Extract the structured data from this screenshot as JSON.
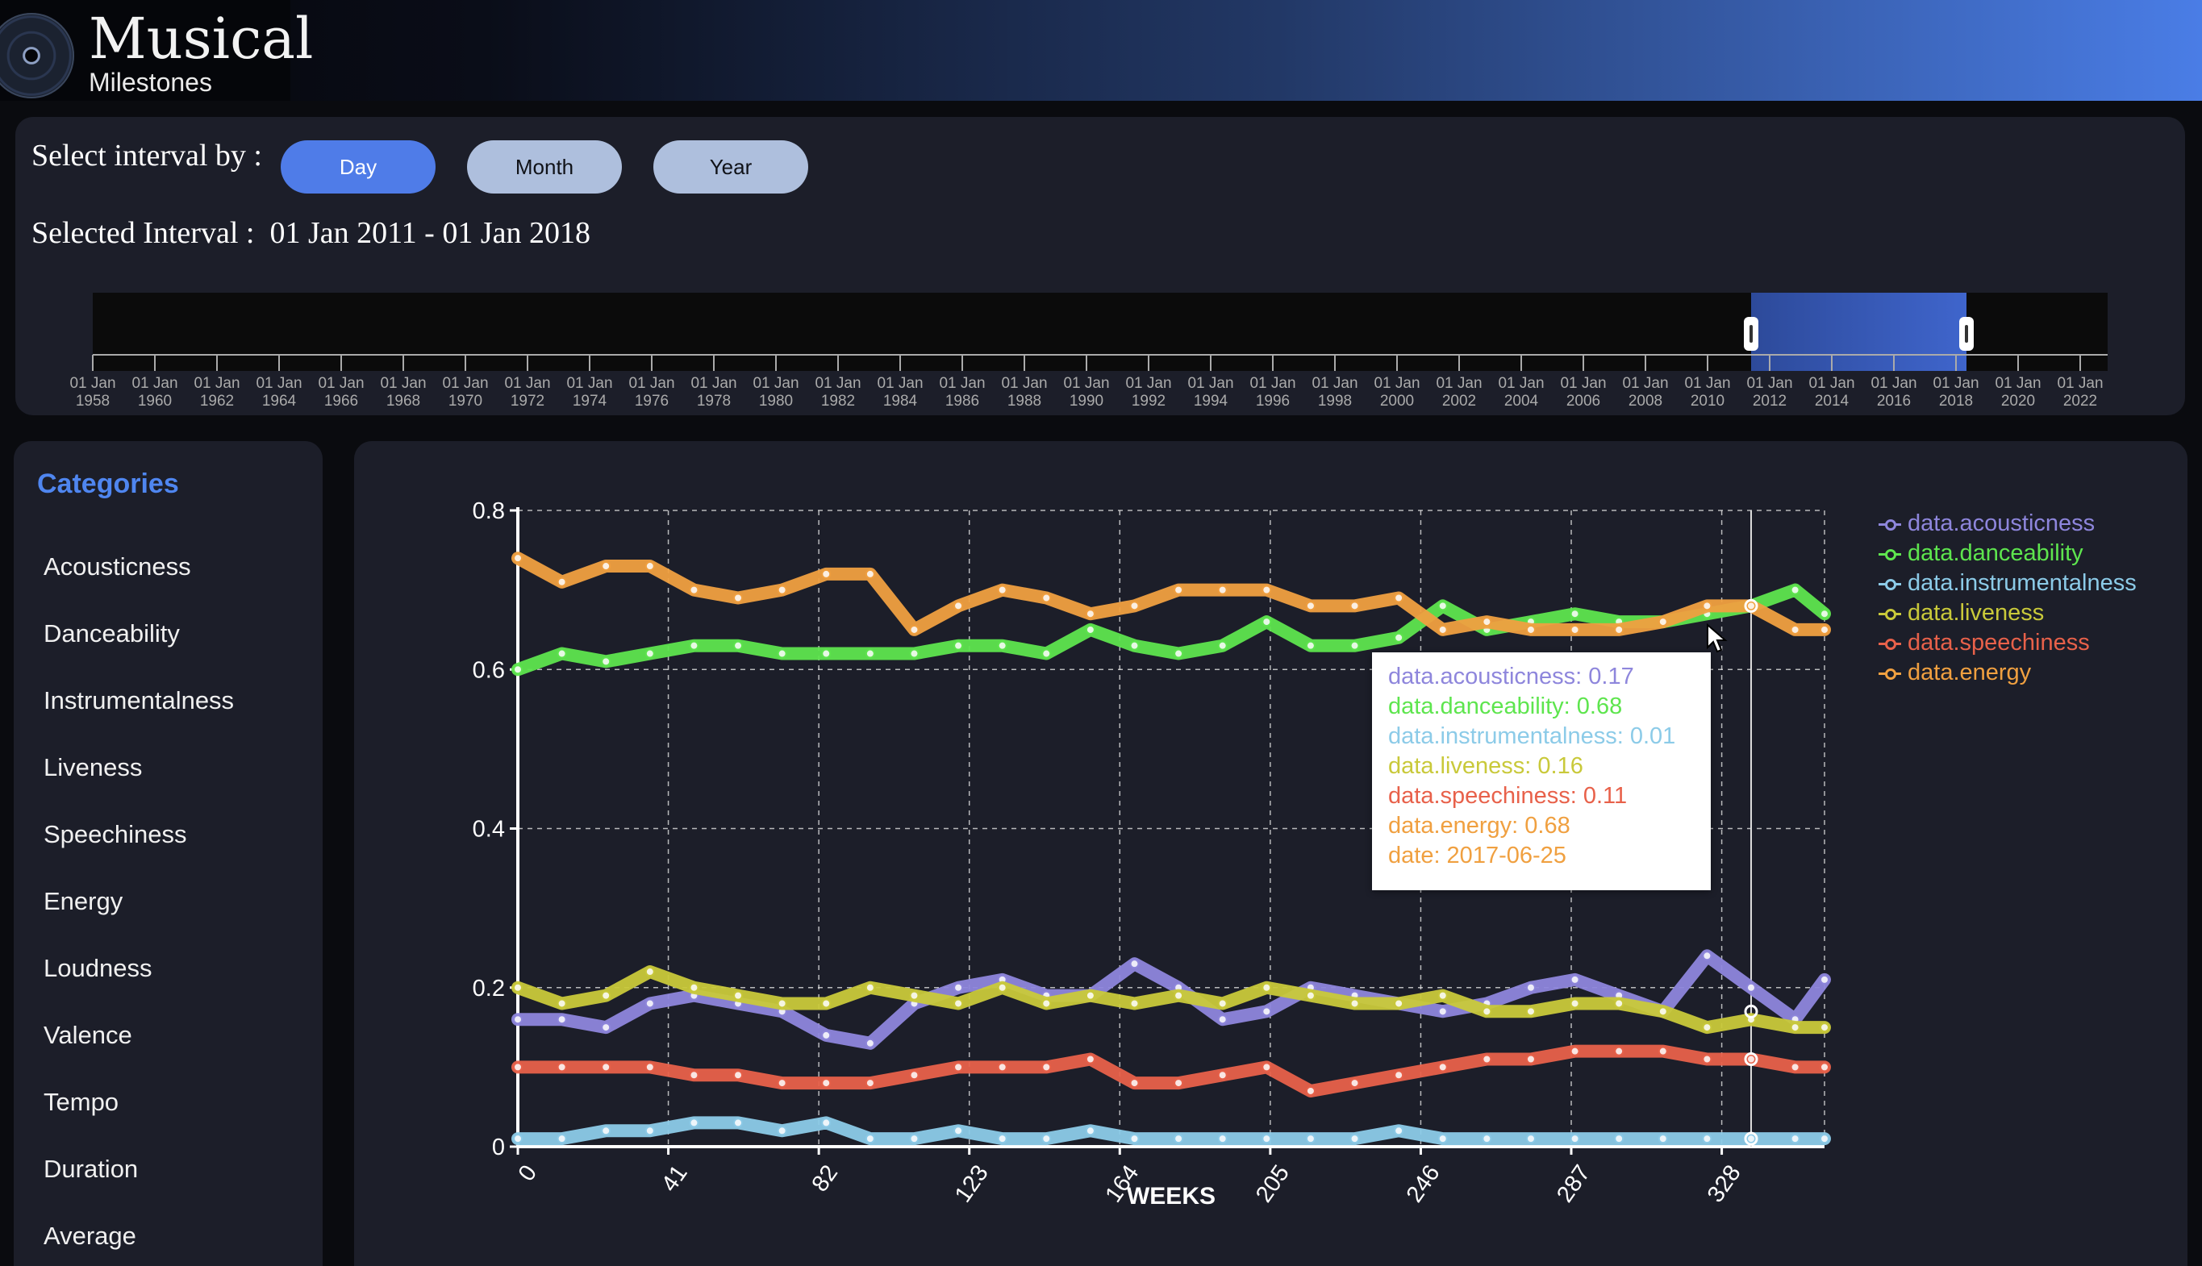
{
  "app": {
    "title": "Musical",
    "subtitle": "Milestones"
  },
  "controls": {
    "interval_label": "Select interval by :",
    "buttons": [
      "Day",
      "Month",
      "Year"
    ],
    "active_button": "Day",
    "selected_label": "Selected Interval :",
    "selected_value": "01 Jan 2011 - 01 Jan 2018"
  },
  "timeline": {
    "ticks": [
      [
        "01 Jan",
        "1958"
      ],
      [
        "01 Jan",
        "1960"
      ],
      [
        "01 Jan",
        "1962"
      ],
      [
        "01 Jan",
        "1964"
      ],
      [
        "01 Jan",
        "1966"
      ],
      [
        "01 Jan",
        "1968"
      ],
      [
        "01 Jan",
        "1970"
      ],
      [
        "01 Jan",
        "1972"
      ],
      [
        "01 Jan",
        "1974"
      ],
      [
        "01 Jan",
        "1976"
      ],
      [
        "01 Jan",
        "1978"
      ],
      [
        "01 Jan",
        "1980"
      ],
      [
        "01 Jan",
        "1982"
      ],
      [
        "01 Jan",
        "1984"
      ],
      [
        "01 Jan",
        "1986"
      ],
      [
        "01 Jan",
        "1988"
      ],
      [
        "01 Jan",
        "1990"
      ],
      [
        "01 Jan",
        "1992"
      ],
      [
        "01 Jan",
        "1994"
      ],
      [
        "01 Jan",
        "1996"
      ],
      [
        "01 Jan",
        "1998"
      ],
      [
        "01 Jan",
        "2000"
      ],
      [
        "01 Jan",
        "2002"
      ],
      [
        "01 Jan",
        "2004"
      ],
      [
        "01 Jan",
        "2006"
      ],
      [
        "01 Jan",
        "2008"
      ],
      [
        "01 Jan",
        "2010"
      ],
      [
        "01 Jan",
        "2012"
      ],
      [
        "01 Jan",
        "2014"
      ],
      [
        "01 Jan",
        "2016"
      ],
      [
        "01 Jan",
        "2018"
      ],
      [
        "01 Jan",
        "2020"
      ],
      [
        "01 Jan",
        "2022"
      ]
    ],
    "brush_start": "2011-01-01",
    "brush_end": "2018-01-01"
  },
  "sidebar": {
    "title": "Categories",
    "items": [
      "Acousticness",
      "Danceability",
      "Instrumentalness",
      "Liveness",
      "Speechiness",
      "Energy",
      "Loudness",
      "Valence",
      "Tempo",
      "Duration",
      "Average"
    ]
  },
  "chart_data": {
    "type": "line",
    "xlabel": "WEEKS",
    "ylabel": "",
    "xlim": [
      0,
      356
    ],
    "ylim": [
      0,
      0.8
    ],
    "xticks": [
      0,
      41,
      82,
      123,
      164,
      205,
      246,
      287,
      328
    ],
    "yticks": [
      0,
      0.2,
      0.4,
      0.6,
      0.8
    ],
    "grid": true,
    "legend_position": "right",
    "x": [
      0,
      12,
      24,
      36,
      48,
      60,
      72,
      84,
      96,
      108,
      120,
      132,
      144,
      156,
      168,
      180,
      192,
      204,
      216,
      228,
      240,
      252,
      264,
      276,
      288,
      300,
      312,
      324,
      336,
      348,
      356
    ],
    "series": [
      {
        "name": "data.acousticness",
        "color": "#8e86dc",
        "values": [
          0.16,
          0.16,
          0.15,
          0.18,
          0.19,
          0.18,
          0.17,
          0.14,
          0.13,
          0.18,
          0.2,
          0.21,
          0.19,
          0.19,
          0.23,
          0.2,
          0.16,
          0.17,
          0.2,
          0.19,
          0.18,
          0.17,
          0.18,
          0.2,
          0.21,
          0.19,
          0.17,
          0.24,
          0.2,
          0.16,
          0.21
        ]
      },
      {
        "name": "data.danceability",
        "color": "#5ee54e",
        "values": [
          0.6,
          0.62,
          0.61,
          0.62,
          0.63,
          0.63,
          0.62,
          0.62,
          0.62,
          0.62,
          0.63,
          0.63,
          0.62,
          0.65,
          0.63,
          0.62,
          0.63,
          0.66,
          0.63,
          0.63,
          0.64,
          0.68,
          0.65,
          0.66,
          0.67,
          0.66,
          0.66,
          0.67,
          0.68,
          0.7,
          0.67
        ]
      },
      {
        "name": "data.instrumentalness",
        "color": "#8ccbe8",
        "values": [
          0.01,
          0.01,
          0.02,
          0.02,
          0.03,
          0.03,
          0.02,
          0.03,
          0.01,
          0.01,
          0.02,
          0.01,
          0.01,
          0.02,
          0.01,
          0.01,
          0.01,
          0.01,
          0.01,
          0.01,
          0.02,
          0.01,
          0.01,
          0.01,
          0.01,
          0.01,
          0.01,
          0.01,
          0.01,
          0.01,
          0.01
        ]
      },
      {
        "name": "data.liveness",
        "color": "#c9c93a",
        "values": [
          0.2,
          0.18,
          0.19,
          0.22,
          0.2,
          0.19,
          0.18,
          0.18,
          0.2,
          0.19,
          0.18,
          0.2,
          0.18,
          0.19,
          0.18,
          0.19,
          0.18,
          0.2,
          0.19,
          0.18,
          0.18,
          0.19,
          0.17,
          0.17,
          0.18,
          0.18,
          0.17,
          0.15,
          0.16,
          0.15,
          0.15
        ]
      },
      {
        "name": "data.speechiness",
        "color": "#e8614a",
        "values": [
          0.1,
          0.1,
          0.1,
          0.1,
          0.09,
          0.09,
          0.08,
          0.08,
          0.08,
          0.09,
          0.1,
          0.1,
          0.1,
          0.11,
          0.08,
          0.08,
          0.09,
          0.1,
          0.07,
          0.08,
          0.09,
          0.1,
          0.11,
          0.11,
          0.12,
          0.12,
          0.12,
          0.11,
          0.11,
          0.1,
          0.1
        ]
      },
      {
        "name": "data.energy",
        "color": "#f0a040",
        "values": [
          0.74,
          0.71,
          0.73,
          0.73,
          0.7,
          0.69,
          0.7,
          0.72,
          0.72,
          0.65,
          0.68,
          0.7,
          0.69,
          0.67,
          0.68,
          0.7,
          0.7,
          0.7,
          0.68,
          0.68,
          0.69,
          0.65,
          0.66,
          0.65,
          0.65,
          0.65,
          0.66,
          0.68,
          0.68,
          0.65,
          0.65
        ]
      }
    ],
    "hover": {
      "x": 336,
      "lines": [
        "data.acousticness: 0.17",
        "data.danceability: 0.68",
        "data.instrumentalness: 0.01",
        "data.liveness: 0.16",
        "data.speechiness: 0.11",
        "data.energy: 0.68",
        "date: 2017-06-25"
      ]
    }
  }
}
